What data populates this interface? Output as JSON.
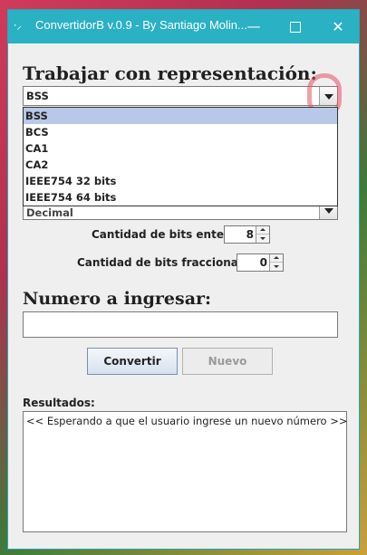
{
  "window": {
    "title": "ConvertidorB v.0.9 - By Santiago Molin...",
    "min_glyph": "—",
    "close_glyph": "✕"
  },
  "representation": {
    "heading": "Trabajar con representación:",
    "selected": "BSS",
    "options": [
      "BSS",
      "BCS",
      "CA1",
      "CA2",
      "IEEE754 32 bits",
      "IEEE754 64 bits"
    ],
    "second_combo_value": "Decimal"
  },
  "bits": {
    "enteros_label": "Cantidad de bits enteros:",
    "enteros_value": "8",
    "fraccionarios_label": "Cantidad de bits fraccionarios:",
    "fraccionarios_value": "0"
  },
  "number": {
    "heading": "Numero a ingresar:",
    "value": ""
  },
  "buttons": {
    "convert": "Convertir",
    "new": "Nuevo"
  },
  "results": {
    "label": "Resultados:",
    "text": "<< Esperando a que el usuario ingrese un nuevo número >>"
  },
  "colors": {
    "titlebar": "#2ab1c3",
    "selection": "#b8c8e6",
    "annotation_circle": "#e65064"
  }
}
